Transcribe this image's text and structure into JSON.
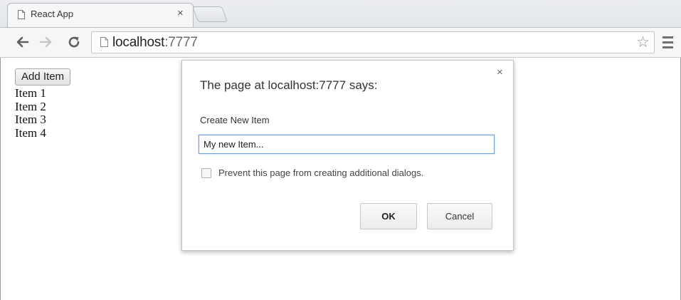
{
  "browser": {
    "tab": {
      "title": "React App",
      "close_glyph": "×"
    },
    "address": {
      "host": "localhost",
      "port": ":7777"
    },
    "icons": [
      "page-icon",
      "back-arrow-icon",
      "forward-arrow-icon",
      "reload-icon",
      "star-icon",
      "menu-icon"
    ]
  },
  "page": {
    "add_button_label": "Add Item",
    "items": [
      "Item 1",
      "Item 2",
      "Item 3",
      "Item 4"
    ]
  },
  "dialog": {
    "title": "The page at localhost:7777 says:",
    "close_glyph": "×",
    "label": "Create New Item",
    "input_value": "My new Item...",
    "checkbox_label": "Prevent this page from creating additional dialogs.",
    "checkbox_checked": false,
    "ok_label": "OK",
    "cancel_label": "Cancel"
  }
}
